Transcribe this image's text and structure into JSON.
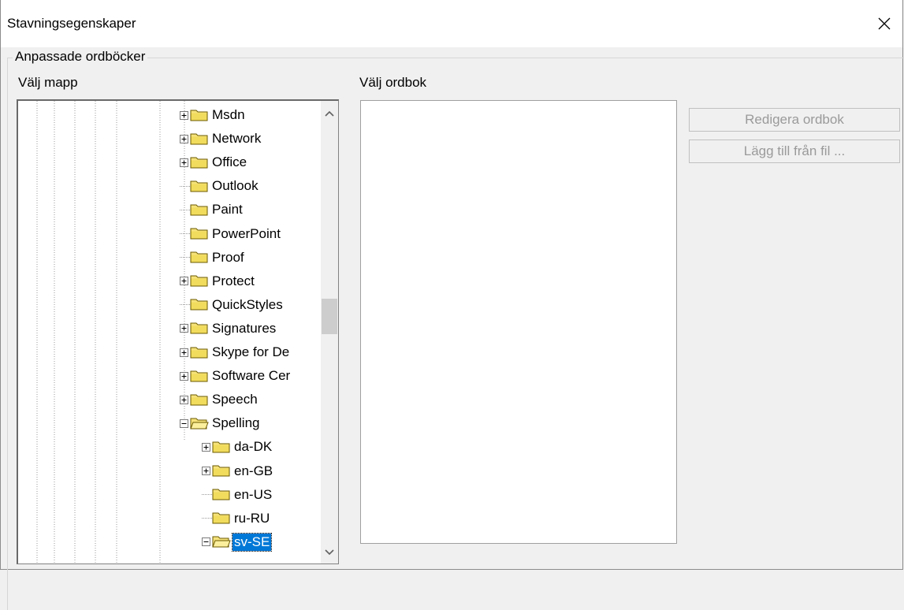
{
  "window": {
    "title": "Stavningsegenskaper"
  },
  "group": {
    "legend": "Anpassade ordböcker",
    "folder_label": "Välj mapp",
    "dict_label": "Välj ordbok"
  },
  "tree": {
    "nodes": [
      {
        "label": "Msdn",
        "expandable": true,
        "expanded": false,
        "level": 0
      },
      {
        "label": "Network",
        "expandable": true,
        "expanded": false,
        "level": 0
      },
      {
        "label": "Office",
        "expandable": true,
        "expanded": false,
        "level": 0
      },
      {
        "label": "Outlook",
        "expandable": false,
        "level": 0
      },
      {
        "label": "Paint",
        "expandable": false,
        "level": 0
      },
      {
        "label": "PowerPoint",
        "expandable": false,
        "level": 0
      },
      {
        "label": "Proof",
        "expandable": false,
        "level": 0
      },
      {
        "label": "Protect",
        "expandable": true,
        "expanded": false,
        "level": 0
      },
      {
        "label": "QuickStyles",
        "expandable": false,
        "level": 0
      },
      {
        "label": "Signatures",
        "expandable": true,
        "expanded": false,
        "level": 0
      },
      {
        "label": "Skype for De",
        "expandable": true,
        "expanded": false,
        "level": 0
      },
      {
        "label": "Software Cer",
        "expandable": true,
        "expanded": false,
        "level": 0
      },
      {
        "label": "Speech",
        "expandable": true,
        "expanded": false,
        "level": 0
      },
      {
        "label": "Spelling",
        "expandable": true,
        "expanded": true,
        "level": 0
      },
      {
        "label": "da-DK",
        "expandable": true,
        "expanded": false,
        "level": 1
      },
      {
        "label": "en-GB",
        "expandable": true,
        "expanded": false,
        "level": 1
      },
      {
        "label": "en-US",
        "expandable": false,
        "level": 1
      },
      {
        "label": "ru-RU",
        "expandable": false,
        "level": 1
      },
      {
        "label": "sv-SE",
        "expandable": true,
        "expanded": true,
        "level": 1,
        "selected": true
      }
    ]
  },
  "buttons": {
    "edit_label": "Redigera ordbok",
    "add_label": "Lägg till från fil ..."
  },
  "colors": {
    "selection": "#0078d7",
    "folder": "#f5e27a",
    "disabled_text": "#9a9a9a"
  },
  "icons": {
    "close": "close-icon",
    "folder": "folder-icon",
    "expand": "plus-box-icon",
    "collapse": "minus-box-icon"
  }
}
